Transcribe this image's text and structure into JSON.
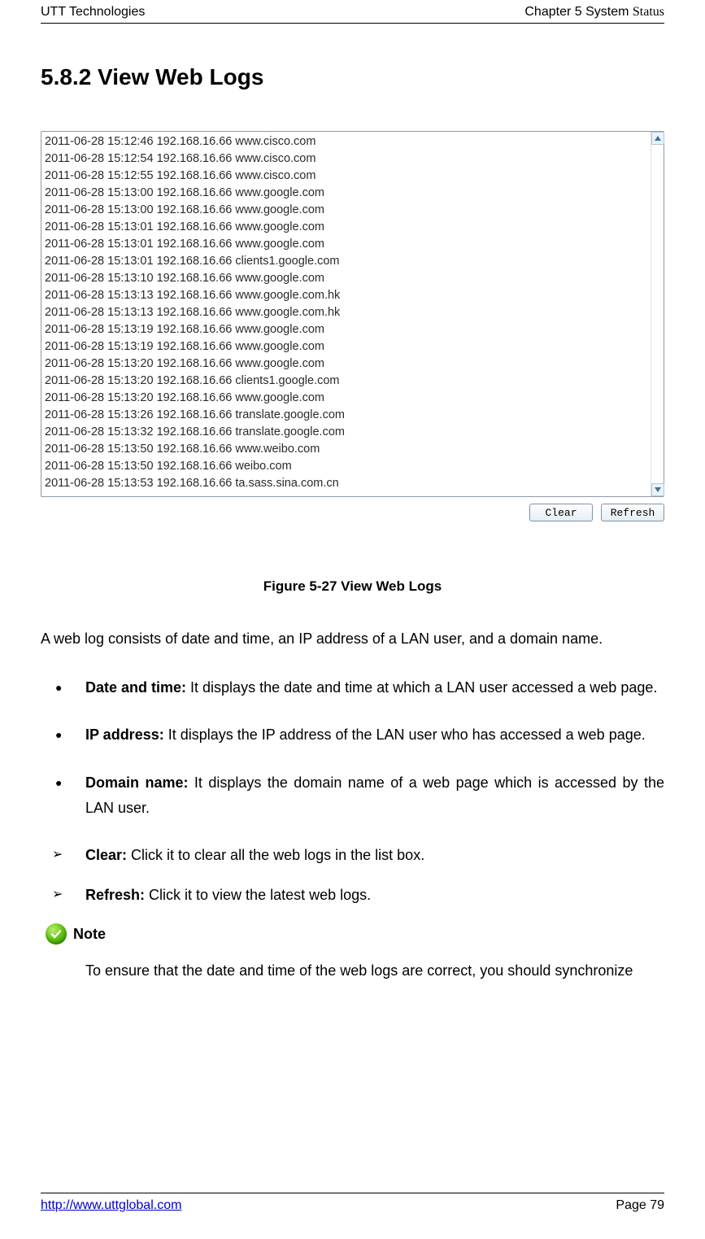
{
  "header": {
    "left": "UTT Technologies",
    "right_prefix": "Chapter 5 System ",
    "right_status": "Status"
  },
  "section_heading": "5.8.2    View Web Logs",
  "log_panel": {
    "rows": [
      {
        "dt": "2011-06-28 15:12:46",
        "ip": "192.168.16.66",
        "host": "www.cisco.com"
      },
      {
        "dt": "2011-06-28 15:12:54",
        "ip": "192.168.16.66",
        "host": "www.cisco.com"
      },
      {
        "dt": "2011-06-28 15:12:55",
        "ip": "192.168.16.66",
        "host": "www.cisco.com"
      },
      {
        "dt": "2011-06-28 15:13:00",
        "ip": "192.168.16.66",
        "host": "www.google.com"
      },
      {
        "dt": "2011-06-28 15:13:00",
        "ip": "192.168.16.66",
        "host": "www.google.com"
      },
      {
        "dt": "2011-06-28 15:13:01",
        "ip": "192.168.16.66",
        "host": "www.google.com"
      },
      {
        "dt": "2011-06-28 15:13:01",
        "ip": "192.168.16.66",
        "host": "www.google.com"
      },
      {
        "dt": "2011-06-28 15:13:01",
        "ip": "192.168.16.66",
        "host": "clients1.google.com"
      },
      {
        "dt": "2011-06-28 15:13:10",
        "ip": "192.168.16.66",
        "host": "www.google.com"
      },
      {
        "dt": "2011-06-28 15:13:13",
        "ip": "192.168.16.66",
        "host": "www.google.com.hk"
      },
      {
        "dt": "2011-06-28 15:13:13",
        "ip": "192.168.16.66",
        "host": "www.google.com.hk"
      },
      {
        "dt": "2011-06-28 15:13:19",
        "ip": "192.168.16.66",
        "host": "www.google.com"
      },
      {
        "dt": "2011-06-28 15:13:19",
        "ip": "192.168.16.66",
        "host": "www.google.com"
      },
      {
        "dt": "2011-06-28 15:13:20",
        "ip": "192.168.16.66",
        "host": "www.google.com"
      },
      {
        "dt": "2011-06-28 15:13:20",
        "ip": "192.168.16.66",
        "host": "clients1.google.com"
      },
      {
        "dt": "2011-06-28 15:13:20",
        "ip": "192.168.16.66",
        "host": "www.google.com"
      },
      {
        "dt": "2011-06-28 15:13:26",
        "ip": "192.168.16.66",
        "host": "translate.google.com"
      },
      {
        "dt": "2011-06-28 15:13:32",
        "ip": "192.168.16.66",
        "host": "translate.google.com"
      },
      {
        "dt": "2011-06-28 15:13:50",
        "ip": "192.168.16.66",
        "host": "www.weibo.com"
      },
      {
        "dt": "2011-06-28 15:13:50",
        "ip": "192.168.16.66",
        "host": "weibo.com"
      },
      {
        "dt": "2011-06-28 15:13:53",
        "ip": "192.168.16.66",
        "host": "ta.sass.sina.com.cn"
      }
    ],
    "buttons": {
      "clear": "Clear",
      "refresh": "Refresh"
    }
  },
  "figure_caption": "Figure 5-27 View Web Logs",
  "intro_para": "A web log consists of date and time, an IP address of a LAN user, and a domain name.",
  "bullets": [
    {
      "label": "Date and time:",
      "text": " It displays the date and time at which a LAN user accessed a web page."
    },
    {
      "label": "IP address:",
      "text": " It displays the IP address of the LAN user who has accessed a web page."
    },
    {
      "label": "Domain name:",
      "text": " It displays the domain name of a web page which is accessed by the LAN user."
    }
  ],
  "actions": [
    {
      "label": "Clear:",
      "text": " Click it to clear all the web logs in the list box."
    },
    {
      "label": "Refresh:",
      "text": " Click it to view the latest web logs."
    }
  ],
  "note": {
    "label": "Note",
    "text": "To ensure that the date and time of the web logs are correct, you should synchronize"
  },
  "footer": {
    "link": "http://www.uttglobal.com",
    "page": "Page 79"
  }
}
